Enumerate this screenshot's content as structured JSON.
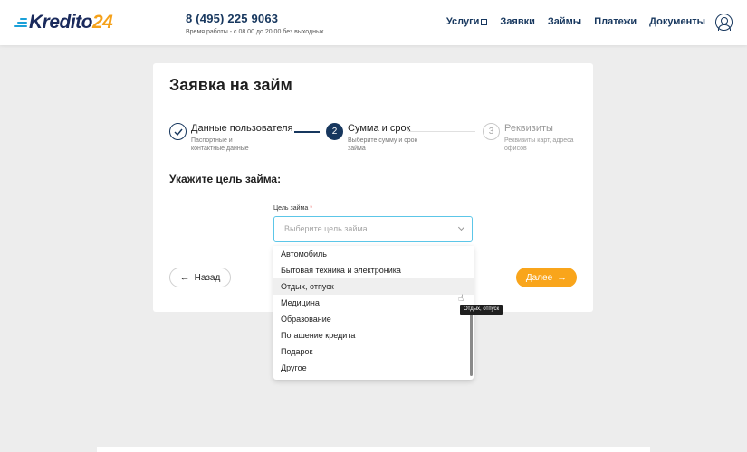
{
  "header": {
    "logo_text": "Kredito",
    "logo_num": "24",
    "phone": "8 (495) 225 9063",
    "hours": "Время работы - с 08.00 до 20.00 без выходных.",
    "nav": [
      "Услуги",
      "Заявки",
      "Займы",
      "Платежи",
      "Документы"
    ],
    "accent": "#17375e",
    "logo_blue": "#1aa0d8",
    "logo_orange": "#f5a11a"
  },
  "form": {
    "title": "Заявка на займ",
    "steps": [
      {
        "label": "Данные пользователя",
        "desc": "Паспортные и контактные данные",
        "icon": "check-icon"
      },
      {
        "label": "Сумма и срок",
        "desc": "Выберите сумму и срок займа",
        "number": "2"
      },
      {
        "label": "Реквизиты",
        "desc": "Реквизиты карт, адреса офисов",
        "number": "3"
      }
    ],
    "section_label": "Укажите цель займа:",
    "field_label": "Цель займа",
    "required_mark": "*",
    "placeholder": "Выберите цель займа",
    "back_label": "Назад",
    "next_label": "Далее",
    "next_color": "#f9a51b",
    "focus_border": "#5cc6e8"
  },
  "dropdown": {
    "options": [
      "Автомобиль",
      "Бытовая техника и электроника",
      "Отдых, отпуск",
      "Медицина",
      "Образование",
      "Погашение кредита",
      "Подарок",
      "Другое"
    ],
    "hovered": "Отдых, отпуск"
  },
  "tooltip": "Отдых, отпуск"
}
